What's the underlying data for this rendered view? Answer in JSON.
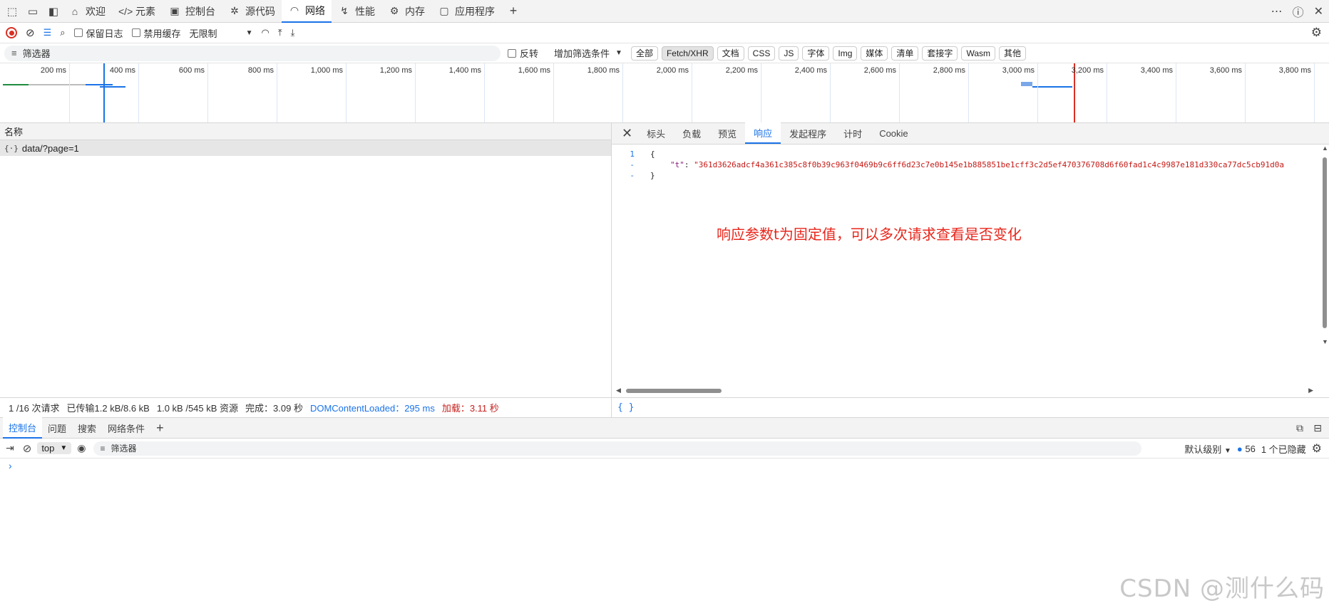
{
  "top_tabs": [
    {
      "label": "欢迎",
      "icon": "home-icon"
    },
    {
      "label": "元素",
      "icon": "code-icon"
    },
    {
      "label": "控制台",
      "icon": "console-icon"
    },
    {
      "label": "源代码",
      "icon": "bug-icon"
    },
    {
      "label": "网络",
      "icon": "wifi-icon"
    },
    {
      "label": "性能",
      "icon": "performance-icon"
    },
    {
      "label": "内存",
      "icon": "memory-icon"
    },
    {
      "label": "应用程序",
      "icon": "application-icon"
    }
  ],
  "active_top_tab": "网络",
  "toolbar": {
    "preserve_log": "保留日志",
    "disable_cache": "禁用缓存",
    "throttling": "无限制"
  },
  "filter": {
    "placeholder": "筛选器",
    "invert": "反转",
    "more_filters": "增加筛选条件",
    "types": [
      "全部",
      "Fetch/XHR",
      "文档",
      "CSS",
      "JS",
      "字体",
      "Img",
      "媒体",
      "清单",
      "套接字",
      "Wasm",
      "其他"
    ],
    "selected_type": "Fetch/XHR"
  },
  "timeline": {
    "ticks": [
      "200 ms",
      "400 ms",
      "600 ms",
      "800 ms",
      "1,000 ms",
      "1,200 ms",
      "1,400 ms",
      "1,600 ms",
      "1,800 ms",
      "2,000 ms",
      "2,200 ms",
      "2,400 ms",
      "2,600 ms",
      "2,800 ms",
      "3,000 ms",
      "3,200 ms",
      "3,400 ms",
      "3,600 ms",
      "3,800 ms"
    ]
  },
  "request_list": {
    "column_name": "名称",
    "rows": [
      {
        "name": "data/?page=1",
        "icon_text": "{·}"
      }
    ]
  },
  "detail": {
    "tabs": [
      "标头",
      "负载",
      "预览",
      "响应",
      "发起程序",
      "计时",
      "Cookie"
    ],
    "active_tab": "响应",
    "code": {
      "line_1_num": "1",
      "line_1": "{",
      "line_2_num": "-",
      "line_2_key": "\"t\"",
      "line_2_sep": ": ",
      "line_2_value": "\"361d3626adcf4a361c385c8f0b39c963f0469b9c6ff6d23c7e0b145e1b885851be1cff3c2d5ef470376708d6f60fad1c4c9987e181d330ca77dc5cb91d0a",
      "line_3_num": "-",
      "line_3": "}"
    },
    "annotation": "响应参数t为固定值，可以多次请求查看是否变化",
    "bottom_badge": "{ }"
  },
  "status_bar": {
    "requests": "1 /16 次请求",
    "transferred": "已传输1.2 kB/8.6 kB",
    "resources": "1.0 kB /545 kB 资源",
    "finish": "完成：3.09 秒",
    "dom_content_loaded": "DOMContentLoaded：295 ms",
    "load": "加载：3.11 秒"
  },
  "drawer": {
    "tabs": [
      "控制台",
      "问题",
      "搜索",
      "网络条件"
    ],
    "active_tab": "控制台"
  },
  "console_toolbar": {
    "context": "top",
    "filter_placeholder": "筛选器",
    "levels": "默认级别",
    "message_count": "56",
    "hidden": "1 个已隐藏"
  },
  "watermark": "CSDN @测什么码",
  "colors": {
    "accent": "#1a73e8",
    "record": "#d93025",
    "annotation": "#e8261b"
  }
}
